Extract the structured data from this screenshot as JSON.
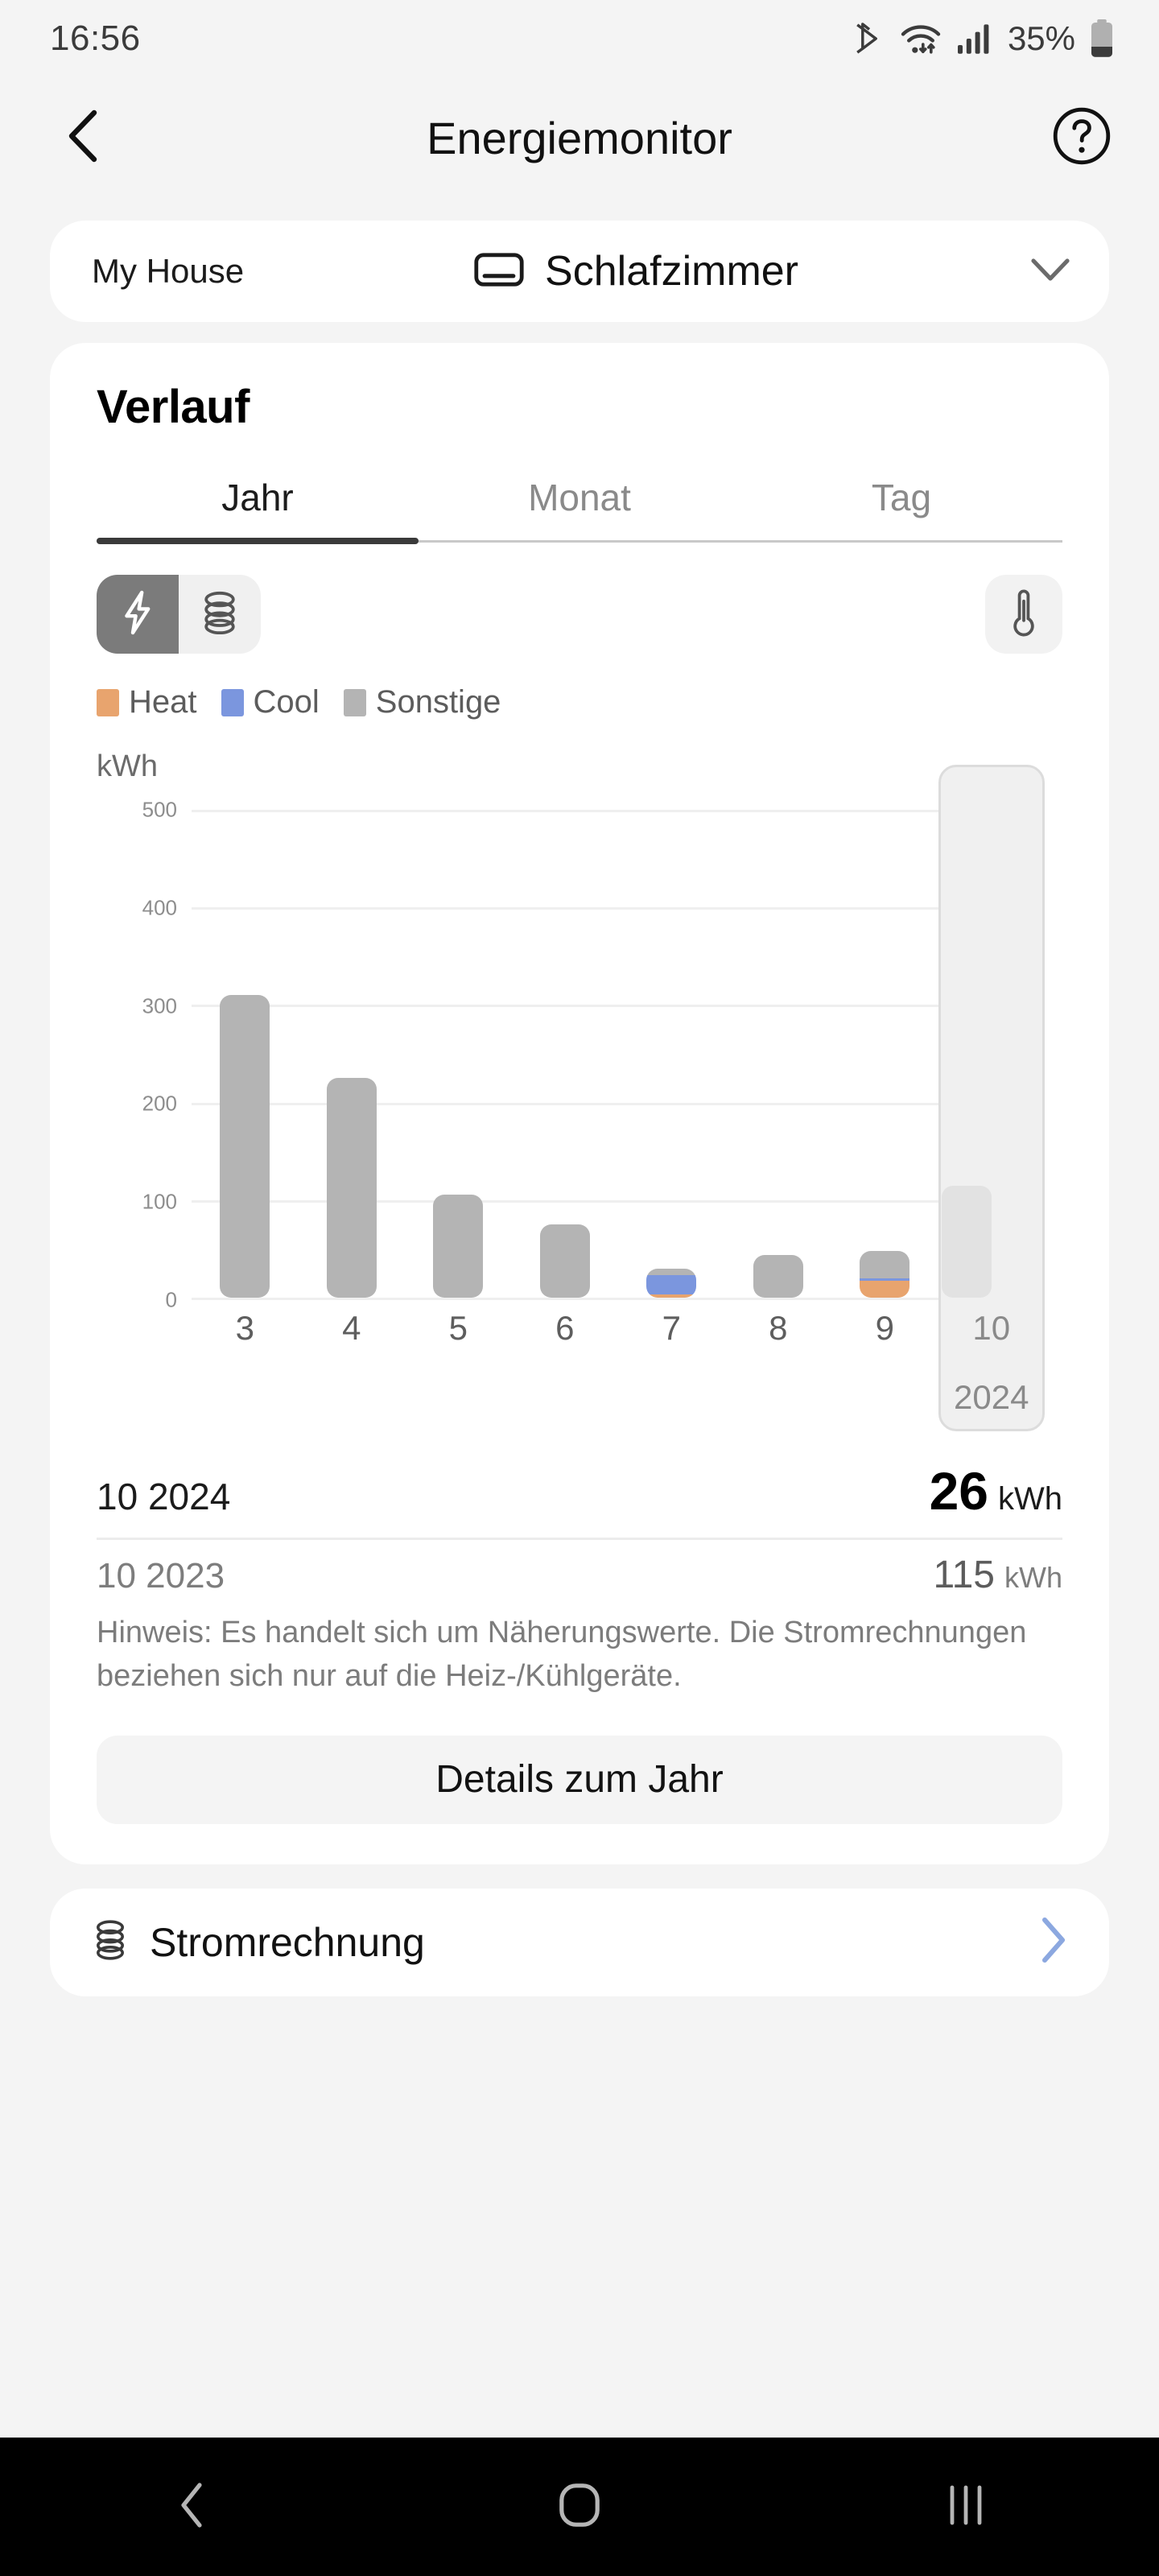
{
  "status_bar": {
    "time": "16:56",
    "battery_percent": "35%",
    "icons": [
      "bluetooth-icon",
      "wifi-icon",
      "signal-icon",
      "battery-icon"
    ]
  },
  "header": {
    "title": "Energiemonitor",
    "back_icon": "chevron-left-icon",
    "help_icon": "question-circle-icon"
  },
  "room_selector": {
    "house": "My House",
    "room": "Schlafzimmer",
    "device_icon": "air-conditioner-icon",
    "chevron_icon": "chevron-down-icon"
  },
  "history": {
    "title": "Verlauf",
    "tabs": [
      {
        "label": "Jahr",
        "active": true
      },
      {
        "label": "Monat",
        "active": false
      },
      {
        "label": "Tag",
        "active": false
      }
    ],
    "mode_toggle": [
      {
        "icon": "lightning-bolt-icon",
        "selected": true
      },
      {
        "icon": "coins-icon",
        "selected": false
      }
    ],
    "temperature_icon": "thermometer-icon",
    "legend": [
      {
        "label": "Heat",
        "color": "#E8A46E"
      },
      {
        "label": "Cool",
        "color": "#7B96DE"
      },
      {
        "label": "Sonstige",
        "color": "#B4B4B4"
      }
    ]
  },
  "chart_data": {
    "type": "bar",
    "title": "Verlauf",
    "unit_label": "kWh",
    "xlabel": "",
    "ylabel": "kWh",
    "ylim": [
      0,
      500
    ],
    "yticks": [
      0,
      100,
      200,
      300,
      400,
      500
    ],
    "grid": true,
    "stacked": true,
    "categories": [
      "3",
      "4",
      "5",
      "6",
      "7",
      "8",
      "9",
      "10"
    ],
    "selected_category": "10",
    "selected_year_label": "2024",
    "series": [
      {
        "name": "Heat",
        "color": "#E8A46E",
        "values": [
          0,
          0,
          0,
          0,
          3,
          0,
          17,
          18
        ]
      },
      {
        "name": "Cool",
        "color": "#7B96DE",
        "values": [
          0,
          0,
          0,
          0,
          20,
          0,
          3,
          0
        ]
      },
      {
        "name": "Sonstige",
        "color": "#B4B4B4",
        "values": [
          310,
          225,
          106,
          75,
          7,
          44,
          28,
          8
        ]
      }
    ],
    "totals": [
      310,
      225,
      106,
      75,
      30,
      44,
      48,
      26
    ],
    "comparison_bar": {
      "category": "10",
      "value": 115,
      "color": "#E2E2E2"
    }
  },
  "summary": {
    "current_period": "10 2024",
    "current_value": "26",
    "current_unit": "kWh",
    "previous_period": "10 2023",
    "previous_value": "115",
    "previous_unit": "kWh",
    "note": "Hinweis: Es handelt sich um Näherungswerte. Die Stromrechnungen beziehen sich nur auf die Heiz-/Kühlgeräte.",
    "details_button": "Details zum Jahr"
  },
  "bill_row": {
    "label": "Stromrechnung",
    "icon": "coins-icon",
    "chevron_icon": "chevron-right-icon",
    "chevron_color": "#8CA8E0"
  },
  "nav_bar": {
    "back_icon": "nav-back-icon",
    "home_icon": "nav-home-icon",
    "recents_icon": "nav-recents-icon"
  }
}
